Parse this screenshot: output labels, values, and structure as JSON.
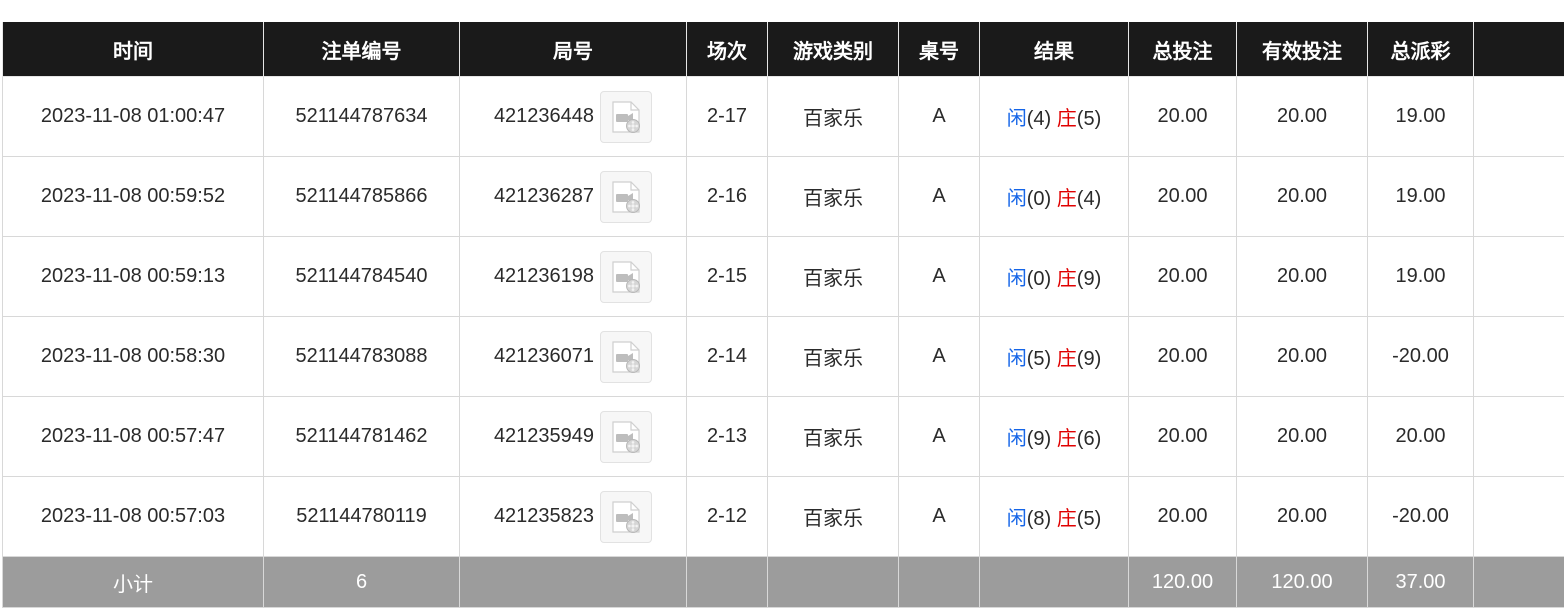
{
  "table": {
    "headers": [
      "时间",
      "注单编号",
      "局号",
      "场次",
      "游戏类别",
      "桌号",
      "结果",
      "总投注",
      "有效投注",
      "总派彩",
      ""
    ],
    "rows": [
      {
        "time": "2023-11-08 01:00:47",
        "bet_id": "521144787634",
        "round_id": "421236448",
        "session": "2-17",
        "game": "百家乐",
        "table": "A",
        "player_label": "闲",
        "player_val": "(4)",
        "banker_label": "庄",
        "banker_val": "(5)",
        "total_bet": "20.00",
        "valid_bet": "20.00",
        "payout": "19.00"
      },
      {
        "time": "2023-11-08 00:59:52",
        "bet_id": "521144785866",
        "round_id": "421236287",
        "session": "2-16",
        "game": "百家乐",
        "table": "A",
        "player_label": "闲",
        "player_val": "(0)",
        "banker_label": "庄",
        "banker_val": "(4)",
        "total_bet": "20.00",
        "valid_bet": "20.00",
        "payout": "19.00"
      },
      {
        "time": "2023-11-08 00:59:13",
        "bet_id": "521144784540",
        "round_id": "421236198",
        "session": "2-15",
        "game": "百家乐",
        "table": "A",
        "player_label": "闲",
        "player_val": "(0)",
        "banker_label": "庄",
        "banker_val": "(9)",
        "total_bet": "20.00",
        "valid_bet": "20.00",
        "payout": "19.00"
      },
      {
        "time": "2023-11-08 00:58:30",
        "bet_id": "521144783088",
        "round_id": "421236071",
        "session": "2-14",
        "game": "百家乐",
        "table": "A",
        "player_label": "闲",
        "player_val": "(5)",
        "banker_label": "庄",
        "banker_val": "(9)",
        "total_bet": "20.00",
        "valid_bet": "20.00",
        "payout": "-20.00"
      },
      {
        "time": "2023-11-08 00:57:47",
        "bet_id": "521144781462",
        "round_id": "421235949",
        "session": "2-13",
        "game": "百家乐",
        "table": "A",
        "player_label": "闲",
        "player_val": "(9)",
        "banker_label": "庄",
        "banker_val": "(6)",
        "total_bet": "20.00",
        "valid_bet": "20.00",
        "payout": "20.00"
      },
      {
        "time": "2023-11-08 00:57:03",
        "bet_id": "521144780119",
        "round_id": "421235823",
        "session": "2-12",
        "game": "百家乐",
        "table": "A",
        "player_label": "闲",
        "player_val": "(8)",
        "banker_label": "庄",
        "banker_val": "(5)",
        "total_bet": "20.00",
        "valid_bet": "20.00",
        "payout": "-20.00"
      }
    ],
    "subtotal": {
      "label": "小计",
      "count": "6",
      "total_bet": "120.00",
      "valid_bet": "120.00",
      "payout": "37.00"
    },
    "video_icon": "video-replay-icon"
  },
  "colors": {
    "header_bg": "#1a1a1a",
    "subtotal_bg": "#9c9c9c",
    "player_blue": "#1565e8",
    "banker_red": "#e00000",
    "negative_red": "#e00000"
  }
}
